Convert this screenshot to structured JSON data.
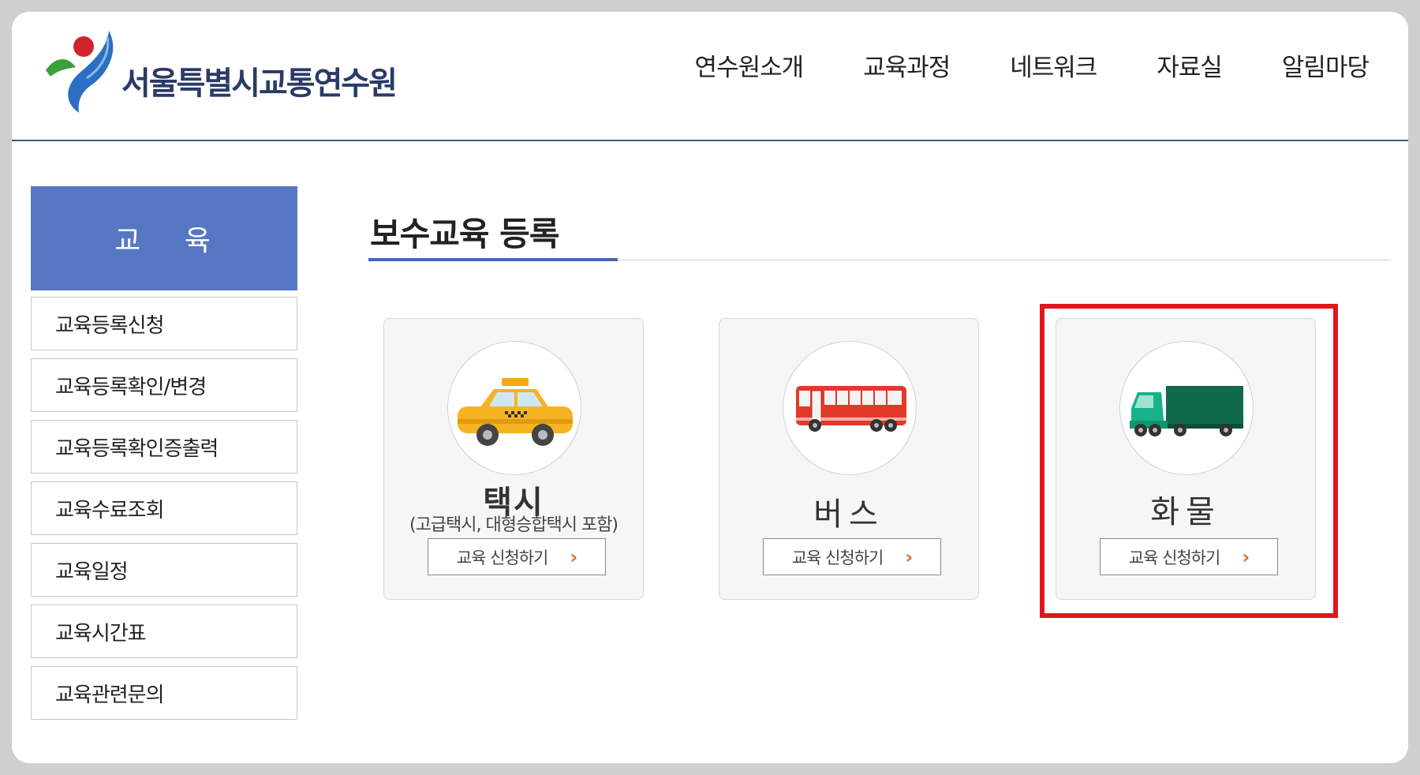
{
  "header": {
    "org_name": "서울특별시교통연수원",
    "nav": [
      "연수원소개",
      "교육과정",
      "네트워크",
      "자료실",
      "알림마당"
    ]
  },
  "sidebar": {
    "title": "교 육",
    "items": [
      {
        "label": "교육등록신청"
      },
      {
        "label": "교육등록확인/변경"
      },
      {
        "label": "교육등록확인증출력"
      },
      {
        "label": "교육수료조회"
      },
      {
        "label": "교육일정"
      },
      {
        "label": "교육시간표"
      },
      {
        "label": "교육관련문의"
      }
    ]
  },
  "main": {
    "title": "보수교육 등록",
    "cards": [
      {
        "title": "택시",
        "subtitle": "(고급택시, 대형승합택시 포함)",
        "button": "교육 신청하기",
        "icon": "taxi-icon"
      },
      {
        "title": "버스",
        "button": "교육 신청하기",
        "icon": "bus-icon"
      },
      {
        "title": "화물",
        "button": "교육 신청하기",
        "icon": "truck-icon",
        "highlighted": true
      }
    ]
  },
  "colors": {
    "sidebar_title_bg": "#5577c4",
    "title_accent": "#4466b3",
    "highlight_border": "#e0161d",
    "chevron": "#ee6a1f"
  }
}
